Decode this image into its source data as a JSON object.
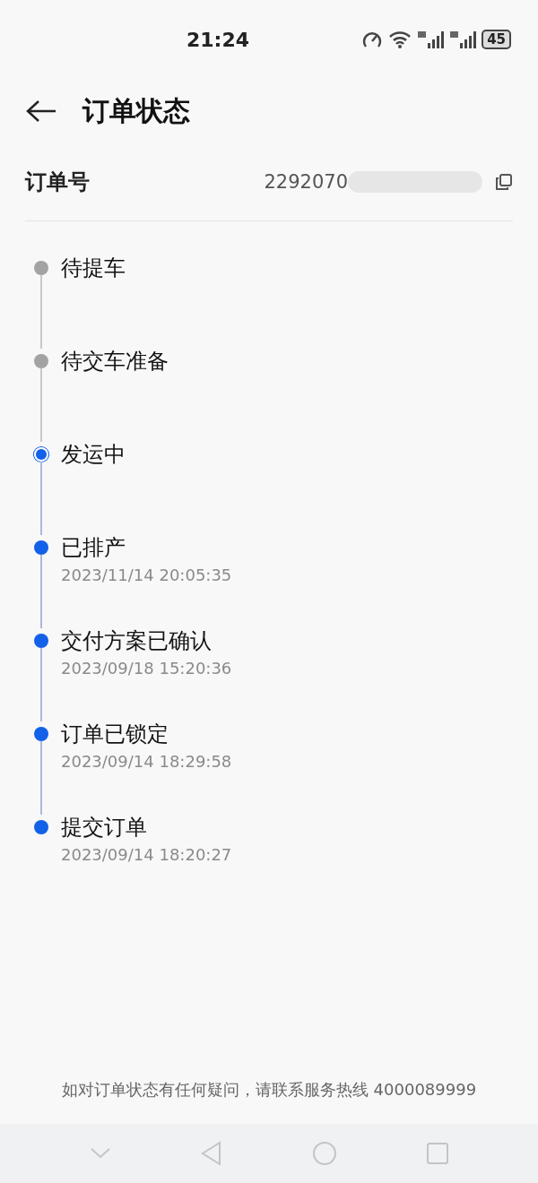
{
  "status_bar": {
    "time": "21:24",
    "battery": "45"
  },
  "header": {
    "title": "订单状态"
  },
  "order": {
    "label": "订单号",
    "number": "2292070"
  },
  "steps": [
    {
      "title": "待提车",
      "kind": "pending"
    },
    {
      "title": "待交车准备",
      "kind": "pending"
    },
    {
      "title": "发运中",
      "kind": "current"
    },
    {
      "title": "已排产",
      "kind": "done",
      "time": "2023/11/14 20:05:35"
    },
    {
      "title": "交付方案已确认",
      "kind": "done",
      "time": "2023/09/18 15:20:36"
    },
    {
      "title": "订单已锁定",
      "kind": "done",
      "time": "2023/09/14 18:29:58"
    },
    {
      "title": "提交订单",
      "kind": "done",
      "time": "2023/09/14 18:20:27"
    }
  ],
  "footer": {
    "note": "如对订单状态有任何疑问，请联系服务热线 4000089999"
  }
}
